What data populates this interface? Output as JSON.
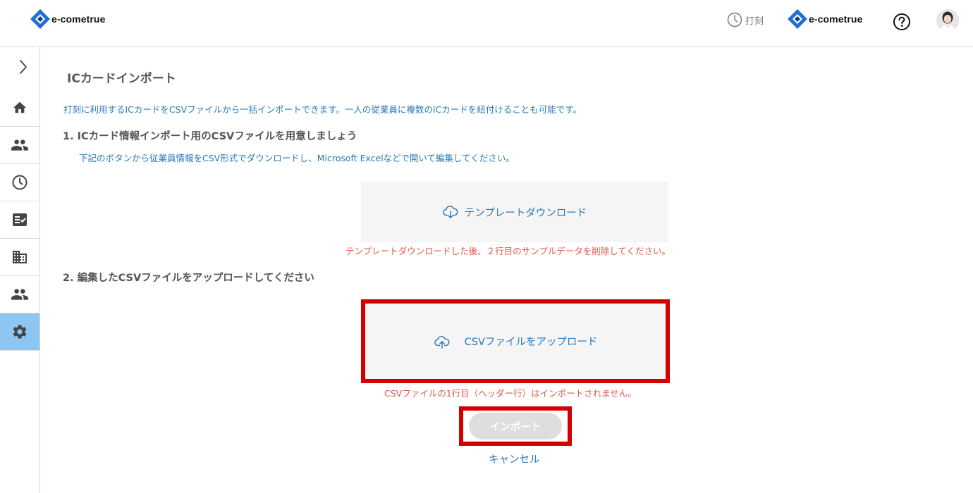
{
  "header": {
    "logo_text": "e-cometrue",
    "punch_label": "打刻",
    "partner_logo_text": "e-cometrue",
    "help_icon": "help-circle-icon",
    "avatar": "user-avatar"
  },
  "sidebar": {
    "toggle_icon": "chevron-right-icon",
    "items": [
      {
        "icon": "home-icon",
        "active": false
      },
      {
        "icon": "people-icon",
        "active": false
      },
      {
        "icon": "clock-icon",
        "active": false
      },
      {
        "icon": "checklist-icon",
        "active": false
      },
      {
        "icon": "building-icon",
        "active": false
      },
      {
        "icon": "people-icon",
        "active": false
      },
      {
        "icon": "gear-icon",
        "active": true
      }
    ]
  },
  "page": {
    "title": "ICカードインポート",
    "intro": "打刻に利用するICカードをCSVファイルから一括インポートできます。一人の従業員に複数のICカードを紐付けることも可能です。",
    "step1_title": "1. ICカード情報インポート用のCSVファイルを用意しましょう",
    "step1_desc": "下記のボタンから従業員情報をCSV形式でダウンロードし、Microsoft Excelなどで開いて編集してください。",
    "template_download_label": "テンプレートダウンロード",
    "template_note": "テンプレートダウンロードした後、２行目のサンプルデータを削除してください。",
    "step2_title": "2. 編集したCSVファイルをアップロードしてください",
    "upload_label": "CSVファイルをアップロード",
    "upload_note": "CSVファイルの1行目（ヘッダー行）はインポートされません。",
    "import_label": "インポート",
    "cancel_label": "キャンセル"
  },
  "colors": {
    "accent_blue": "#2a7ab8",
    "logo_blue": "#1f6fd6",
    "warning_red": "#e05a4a",
    "highlight_red": "#d40000",
    "sidebar_active": "#8dc7f1",
    "disabled_button": "#dedede"
  }
}
